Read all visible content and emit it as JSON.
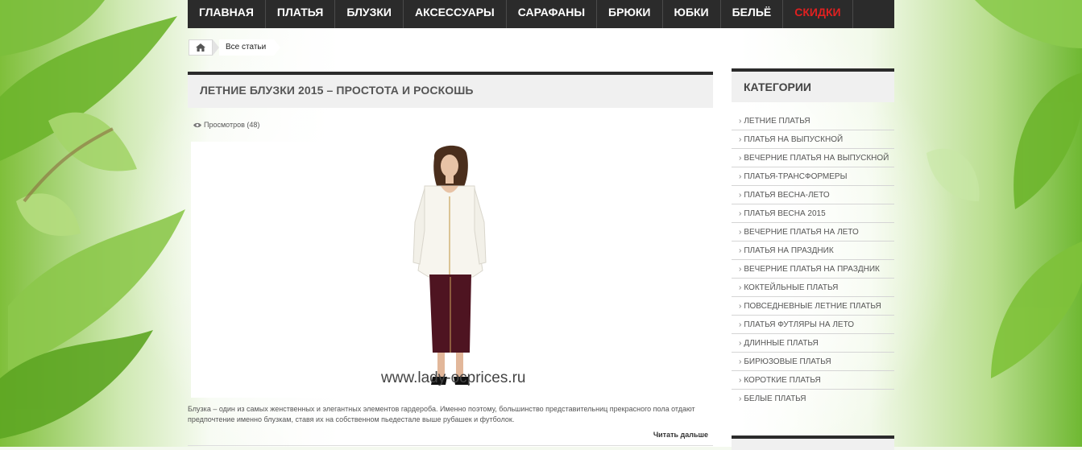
{
  "nav": {
    "items": [
      {
        "label": "ГЛАВНАЯ"
      },
      {
        "label": "ПЛАТЬЯ"
      },
      {
        "label": "БЛУЗКИ"
      },
      {
        "label": "АКСЕССУАРЫ"
      },
      {
        "label": "САРАФАНЫ"
      },
      {
        "label": "БРЮКИ"
      },
      {
        "label": "ЮБКИ"
      },
      {
        "label": "БЕЛЬЁ"
      },
      {
        "label": "СКИДКИ",
        "color": "#e02020"
      }
    ]
  },
  "breadcrumb": {
    "home_icon": "home-icon",
    "current": "Все статьи"
  },
  "article": {
    "title": "ЛЕТНИЕ БЛУЗКИ 2015 – ПРОСТОТА И РОСКОШЬ",
    "views_icon": "eye-icon",
    "views": "Просмотров (48)",
    "image_watermark": "www.lady-ocprices.ru",
    "excerpt": "Блузка – один из самых женственных и элегантных элементов гардероба. Именно поэтому, большинство представительниц прекрасного пола отдают предпочтение именно блузкам, ставя их на собственном пьедестале выше рубашек и футболок.",
    "read_more": "Читать дальше"
  },
  "sidebar": {
    "title": "КАТЕГОРИИ",
    "categories": [
      "ЛЕТНИЕ ПЛАТЬЯ",
      "ПЛАТЬЯ НА ВЫПУСКНОЙ",
      "ВЕЧЕРНИЕ ПЛАТЬЯ НА ВЫПУСКНОЙ",
      "ПЛАТЬЯ-ТРАНСФОРМЕРЫ",
      "ПЛАТЬЯ ВЕСНА-ЛЕТО",
      "ПЛАТЬЯ ВЕСНА 2015",
      "ВЕЧЕРНИЕ ПЛАТЬЯ НА ЛЕТО",
      "ПЛАТЬЯ НА ПРАЗДНИК",
      "ВЕЧЕРНИЕ ПЛАТЬЯ НА ПРАЗДНИК",
      "КОКТЕЙЛЬНЫЕ ПЛАТЬЯ",
      "ПОВСЕДНЕВНЫЕ ЛЕТНИЕ ПЛАТЬЯ",
      "ПЛАТЬЯ ФУТЛЯРЫ НА ЛЕТО",
      "ДЛИННЫЕ ПЛАТЬЯ",
      "БИРЮЗОВЫЕ ПЛАТЬЯ",
      "КОРОТКИЕ ПЛАТЬЯ",
      "БЕЛЫЕ ПЛАТЬЯ"
    ]
  },
  "colors": {
    "nav_bg": "#2b2b2b",
    "sale": "#e02020",
    "leaf_green": "#7fc23a"
  }
}
